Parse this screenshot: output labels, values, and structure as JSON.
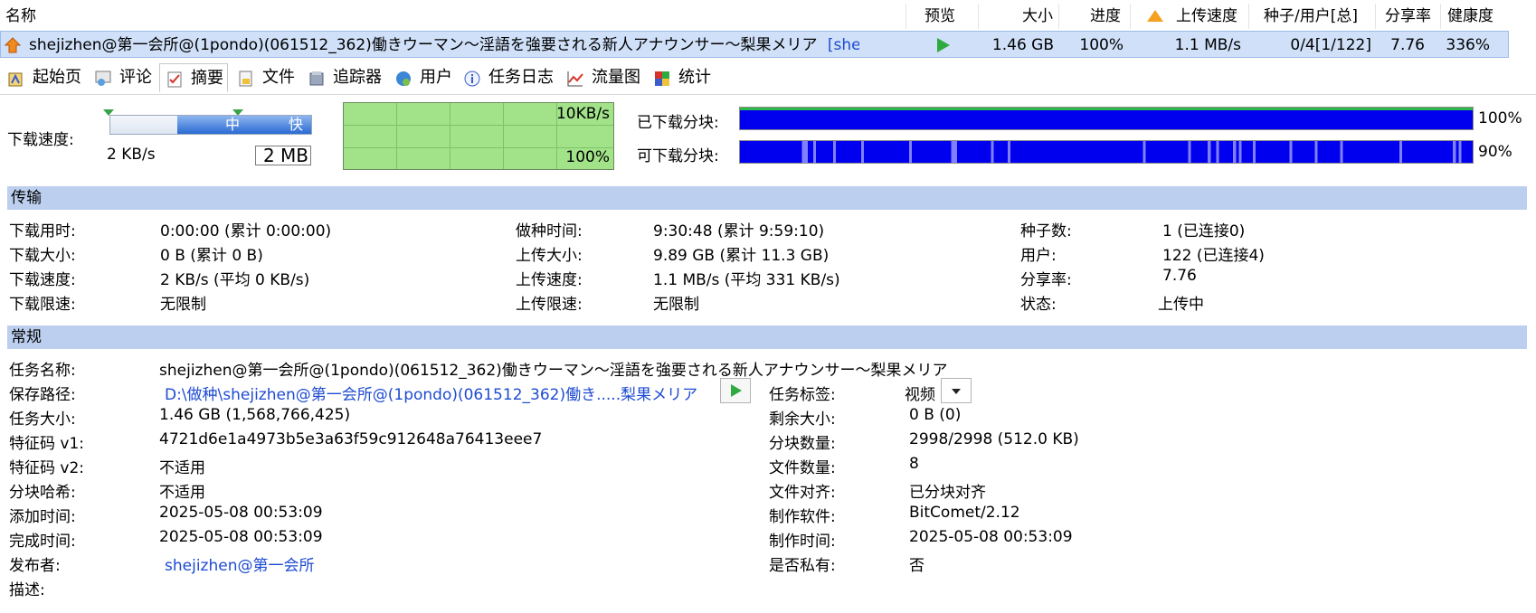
{
  "list": {
    "headers": [
      "名称",
      "预览",
      "大小",
      "进度",
      "上传速度",
      "种子/用户[总]",
      "分享率",
      "健康度"
    ],
    "row": {
      "name": "shejizhen@第一会所@(1pondo)(061512_362)働きウーマン～淫語を強要される新人アナウンサー～梨果メリア",
      "tag": "[shej...",
      "size": "1.46 GB",
      "progress": "100%",
      "upload_speed": "1.1 MB/s",
      "seeds_peers": "0/4[1/122]",
      "ratio": "7.76",
      "health": "336%"
    }
  },
  "tabs": [
    "起始页",
    "评论",
    "摘要",
    "文件",
    "追踪器",
    "用户",
    "任务日志",
    "流量图",
    "统计"
  ],
  "tab_icons": [
    "home-icon",
    "comment-icon",
    "summary-icon",
    "file-icon",
    "tracker-icon",
    "users-icon",
    "info-icon",
    "chart-icon",
    "stats-icon"
  ],
  "active_tab": 2,
  "speed": {
    "label": "下载速度:",
    "slider_mid": "中",
    "slider_fast": "快",
    "current": "2 KB/s",
    "cache": "2 MB",
    "graph_top": "10KB/s",
    "graph_bottom": "100%"
  },
  "pieces": {
    "downloaded_label": "已下载分块:",
    "downloaded_pct": "100%",
    "downloaded_fraction": 1.0,
    "available_label": "可下载分块:",
    "available_pct": "90%",
    "available_fraction": 0.9,
    "colors": {
      "bar": "#0000ee",
      "bar_light": "#8080ff",
      "green_line": "#2db84a"
    }
  },
  "transfer": {
    "title": "传输",
    "col1": [
      {
        "label": "下载用时:",
        "value": "0:00:00 (累计 0:00:00)"
      },
      {
        "label": "下载大小:",
        "value": "0 B (累计 0 B)"
      },
      {
        "label": "下载速度:",
        "value": "2 KB/s (平均 0 KB/s)"
      },
      {
        "label": "下载限速:",
        "value": "无限制"
      }
    ],
    "col2": [
      {
        "label": "做种时间:",
        "value": "9:30:48 (累计 9:59:10)"
      },
      {
        "label": "上传大小:",
        "value": "9.89 GB (累计 11.3 GB)"
      },
      {
        "label": "上传速度:",
        "value": "1.1 MB/s (平均 331 KB/s)"
      },
      {
        "label": "上传限速:",
        "value": "无限制"
      }
    ],
    "col3": [
      {
        "label": "种子数:",
        "value": "1 (已连接0)"
      },
      {
        "label": "用户:",
        "value": "122 (已连接4)"
      },
      {
        "label": "分享率:",
        "value": "7.76"
      },
      {
        "label": "状态:",
        "value": "上传中"
      }
    ]
  },
  "general": {
    "title": "常规",
    "left": [
      {
        "label": "任务名称:",
        "value": "shejizhen@第一会所@(1pondo)(061512_362)働きウーマン～淫語を強要される新人アナウンサー～梨果メリア"
      },
      {
        "label": "保存路径:",
        "value": "D:\\做种\\shejizhen@第一会所@(1pondo)(061512_362)働き.....梨果メリア"
      },
      {
        "label": "任务大小:",
        "value": "1.46 GB (1,568,766,425)"
      },
      {
        "label": "特征码 v1:",
        "value": "4721d6e1a4973b5e3a63f59c912648a76413eee7"
      },
      {
        "label": "特征码 v2:",
        "value": "不适用"
      },
      {
        "label": "分块哈希:",
        "value": "不适用"
      },
      {
        "label": "添加时间:",
        "value": "2025-05-08 00:53:09"
      },
      {
        "label": "完成时间:",
        "value": "2025-05-08 00:53:09"
      },
      {
        "label": "发布者:",
        "value": "shejizhen@第一会所"
      },
      {
        "label": "描述:",
        "value": ""
      }
    ],
    "right": [
      {
        "label": "任务标签:",
        "value": "视频"
      },
      {
        "label": "剩余大小:",
        "value": "0 B (0)"
      },
      {
        "label": "分块数量:",
        "value": "2998/2998 (512.0 KB)"
      },
      {
        "label": "文件数量:",
        "value": "8"
      },
      {
        "label": "文件对齐:",
        "value": "已分块对齐"
      },
      {
        "label": "制作软件:",
        "value": "BitComet/2.12"
      },
      {
        "label": "制作时间:",
        "value": "2025-05-08 00:53:09"
      },
      {
        "label": "是否私有:",
        "value": "否"
      }
    ]
  }
}
